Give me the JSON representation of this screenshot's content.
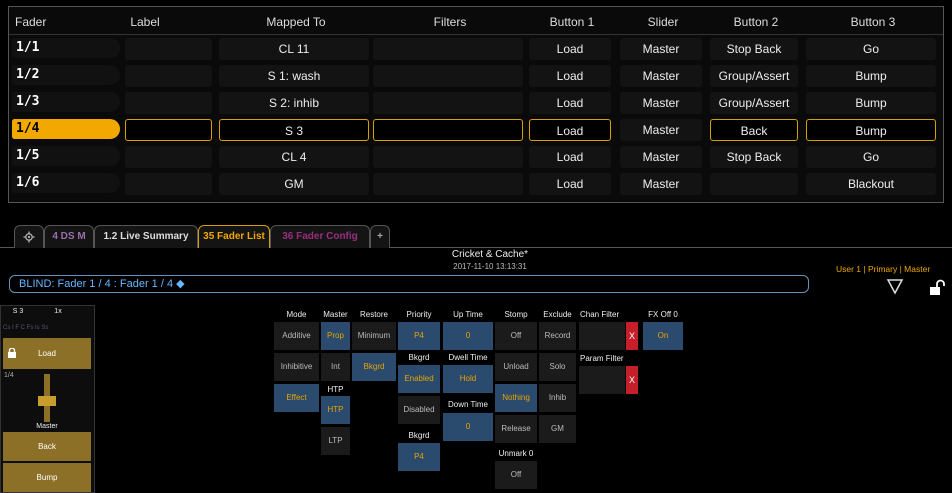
{
  "table": {
    "headers": {
      "fader": "Fader",
      "label": "Label",
      "mapped": "Mapped To",
      "filters": "Filters",
      "button1": "Button 1",
      "slider": "Slider",
      "button2": "Button 2",
      "button3": "Button 3"
    },
    "rows": [
      {
        "fader": "1/1",
        "label": "",
        "mapped": "CL 11",
        "filters": "",
        "button1": "Load",
        "slider": "Master",
        "button2": "Stop Back",
        "button3": "Go"
      },
      {
        "fader": "1/2",
        "label": "",
        "mapped": "S 1: wash",
        "filters": "",
        "button1": "Load",
        "slider": "Master",
        "button2": "Group/Assert",
        "button3": "Bump"
      },
      {
        "fader": "1/3",
        "label": "",
        "mapped": "S 2: inhib",
        "filters": "",
        "button1": "Load",
        "slider": "Master",
        "button2": "Group/Assert",
        "button3": "Bump"
      },
      {
        "fader": "1/4",
        "label": "",
        "mapped": "S 3",
        "filters": "",
        "button1": "Load",
        "slider": "Master",
        "button2": "Back",
        "button3": "Bump"
      },
      {
        "fader": "1/5",
        "label": "",
        "mapped": "CL 4",
        "filters": "",
        "button1": "Load",
        "slider": "Master",
        "button2": "Stop Back",
        "button3": "Go"
      },
      {
        "fader": "1/6",
        "label": "",
        "mapped": "GM",
        "filters": "",
        "button1": "Load",
        "slider": "Master",
        "button2": "",
        "button3": "Blackout"
      }
    ]
  },
  "tabs": {
    "settings_icon": "gear-icon",
    "t1": "4 DS  M",
    "t2": "1.2 Live Summary",
    "t3": "35 Fader List",
    "t4": "36 Fader Config",
    "t5": "+"
  },
  "header": {
    "show": "Cricket & Cache*",
    "time": "2017-11-10 13:13:31",
    "user": "User 1 | Primary | Master"
  },
  "cmdline": {
    "text": "BLIND: Fader  1 / 4 :  Fader 1 / 4 ◆"
  },
  "panel": {
    "id": "S 3",
    "rate": "1x",
    "flags": "Cs I  F  C  Fs  Is  Ss",
    "load": "Load",
    "fader_label": "1/4",
    "master": "Master",
    "back": "Back",
    "bump": "Bump"
  },
  "settings": {
    "mode": {
      "title": "Mode",
      "opts": [
        "Additive",
        "Inhibitive",
        "Effect"
      ]
    },
    "master": {
      "title": "Master",
      "opts": [
        "Prop",
        "Int"
      ],
      "htp_title": "HTP",
      "htp_opts": [
        "HTP",
        "LTP"
      ]
    },
    "restore": {
      "title": "Restore",
      "opts": [
        "Minimum",
        "Bkgrd"
      ]
    },
    "priority": {
      "title": "Priority",
      "val": "P4",
      "bkgrd_title": "Bkgrd",
      "bkgrd_opts": [
        "Enabled",
        "Disabled"
      ],
      "bkgrd2_title": "Bkgrd",
      "bkgrd2_val": "P4"
    },
    "uptime": {
      "title": "Up Time",
      "val": "0",
      "dwell_title": "Dwell Time",
      "dwell_val": "Hold",
      "down_title": "Down Time",
      "down_val": "0"
    },
    "stomp": {
      "title": "Stomp",
      "opts": [
        "Off",
        "Unload",
        "Nothing",
        "Release"
      ],
      "unmark_title": "Unmark 0",
      "unmark_val": "Off"
    },
    "exclude": {
      "title": "Exclude",
      "opts": [
        "Record",
        "Solo",
        "Inhib",
        "GM"
      ]
    },
    "chan_filter": {
      "title": "Chan Filter",
      "x": "X"
    },
    "param_filter": {
      "title": "Param Filter",
      "x": "X"
    },
    "fx_off": {
      "title": "FX Off 0",
      "val": "On"
    }
  }
}
